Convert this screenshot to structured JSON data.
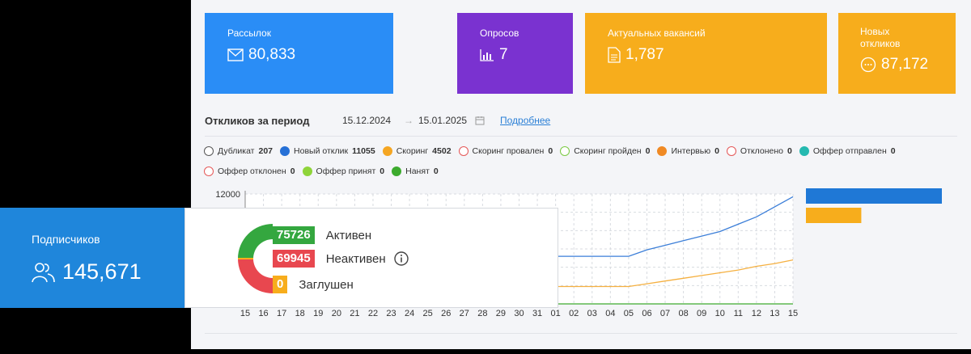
{
  "cards": {
    "mailings": {
      "label": "Рассылок",
      "value": "80,833",
      "icon": "envelope-icon",
      "color": "#2a8df6"
    },
    "polls": {
      "label": "Опросов",
      "value": "7",
      "icon": "bar-chart-icon",
      "color": "#7a32d0"
    },
    "vacancies": {
      "label": "Актуальных вакансий",
      "value": "1,787",
      "icon": "document-icon",
      "color": "#f7ad1c"
    },
    "responses": {
      "label_line1": "Новых",
      "label_line2": "откликов",
      "value": "87,172",
      "icon": "chat-bubble-icon",
      "color": "#f7ad1c"
    }
  },
  "period": {
    "title": "Откликов за период",
    "date_from": "15.12.2024",
    "arrow": "→",
    "date_to": "15.01.2025",
    "link": "Подробнее"
  },
  "legend": [
    {
      "label": "Дубликат",
      "count": "207",
      "color": "#ffffff",
      "border": "#555555"
    },
    {
      "label": "Новый отклик",
      "count": "11055",
      "color": "#2670d6",
      "border": "#2670d6"
    },
    {
      "label": "Скоринг",
      "count": "4502",
      "color": "#f5a623",
      "border": "#f5a623"
    },
    {
      "label": "Скоринг провален",
      "count": "0",
      "color": "#ffffff",
      "border": "#e45757"
    },
    {
      "label": "Скоринг пройден",
      "count": "0",
      "color": "#ffffff",
      "border": "#7ac943"
    },
    {
      "label": "Интервью",
      "count": "0",
      "color": "#f08a24",
      "border": "#f08a24"
    },
    {
      "label": "Отклонено",
      "count": "0",
      "color": "#ffffff",
      "border": "#e45757"
    },
    {
      "label": "Оффер отправлен",
      "count": "0",
      "color": "#25b9b0",
      "border": "#25b9b0"
    },
    {
      "label": "Оффер отклонен",
      "count": "0",
      "color": "#ffffff",
      "border": "#e45757"
    },
    {
      "label": "Оффер принят",
      "count": "0",
      "color": "#8fd43a",
      "border": "#8fd43a"
    },
    {
      "label": "Нанят",
      "count": "0",
      "color": "#3dab2e",
      "border": "#3dab2e"
    }
  ],
  "chart_data": {
    "type": "line",
    "x": [
      "15",
      "16",
      "17",
      "18",
      "19",
      "20",
      "21",
      "22",
      "23",
      "24",
      "25",
      "26",
      "27",
      "28",
      "29",
      "30",
      "31",
      "01",
      "02",
      "03",
      "04",
      "05",
      "06",
      "07",
      "08",
      "09",
      "10",
      "11",
      "12",
      "13",
      "15"
    ],
    "ylim": [
      0,
      12000
    ],
    "y_ticks": [
      "12000"
    ],
    "series": [
      {
        "name": "Новый отклик",
        "color": "#3b7ed8",
        "values": [
          5200,
          5200,
          5200,
          5200,
          5200,
          5200,
          5200,
          5200,
          5200,
          5200,
          5200,
          5200,
          5200,
          5200,
          5200,
          5200,
          5200,
          5200,
          5200,
          5200,
          5200,
          5200,
          5900,
          6400,
          6900,
          7400,
          7900,
          8700,
          9500,
          10600,
          11700
        ]
      },
      {
        "name": "Скоринг",
        "color": "#f5b040",
        "values": [
          1900,
          1900,
          1900,
          1900,
          1900,
          1900,
          1900,
          1900,
          1900,
          1900,
          1900,
          1900,
          1900,
          1900,
          1900,
          1900,
          1900,
          1900,
          1900,
          1900,
          1900,
          1900,
          2200,
          2500,
          2800,
          3100,
          3400,
          3700,
          4100,
          4400,
          4800
        ]
      },
      {
        "name": "Нанят",
        "color": "#3dab2e",
        "values": [
          0,
          0,
          0,
          0,
          0,
          0,
          0,
          0,
          0,
          0,
          0,
          0,
          0,
          0,
          0,
          0,
          0,
          0,
          0,
          0,
          0,
          0,
          0,
          0,
          0,
          0,
          0,
          0,
          0,
          0,
          0
        ]
      }
    ],
    "bars": [
      {
        "value": 11055,
        "color": "#1f78d6"
      },
      {
        "value": 4502,
        "color": "#f7ad1c"
      }
    ]
  },
  "subscribers": {
    "label": "Подписчиков",
    "value": "145,671",
    "icon": "users-icon"
  },
  "statuses": [
    {
      "count": "75726",
      "label": "Активен",
      "color": "#34a73f"
    },
    {
      "count": "69945",
      "label": "Неактивен",
      "color": "#e8474f"
    },
    {
      "count": "0",
      "label": "Заглушен",
      "color": "#f7ad1c"
    }
  ]
}
